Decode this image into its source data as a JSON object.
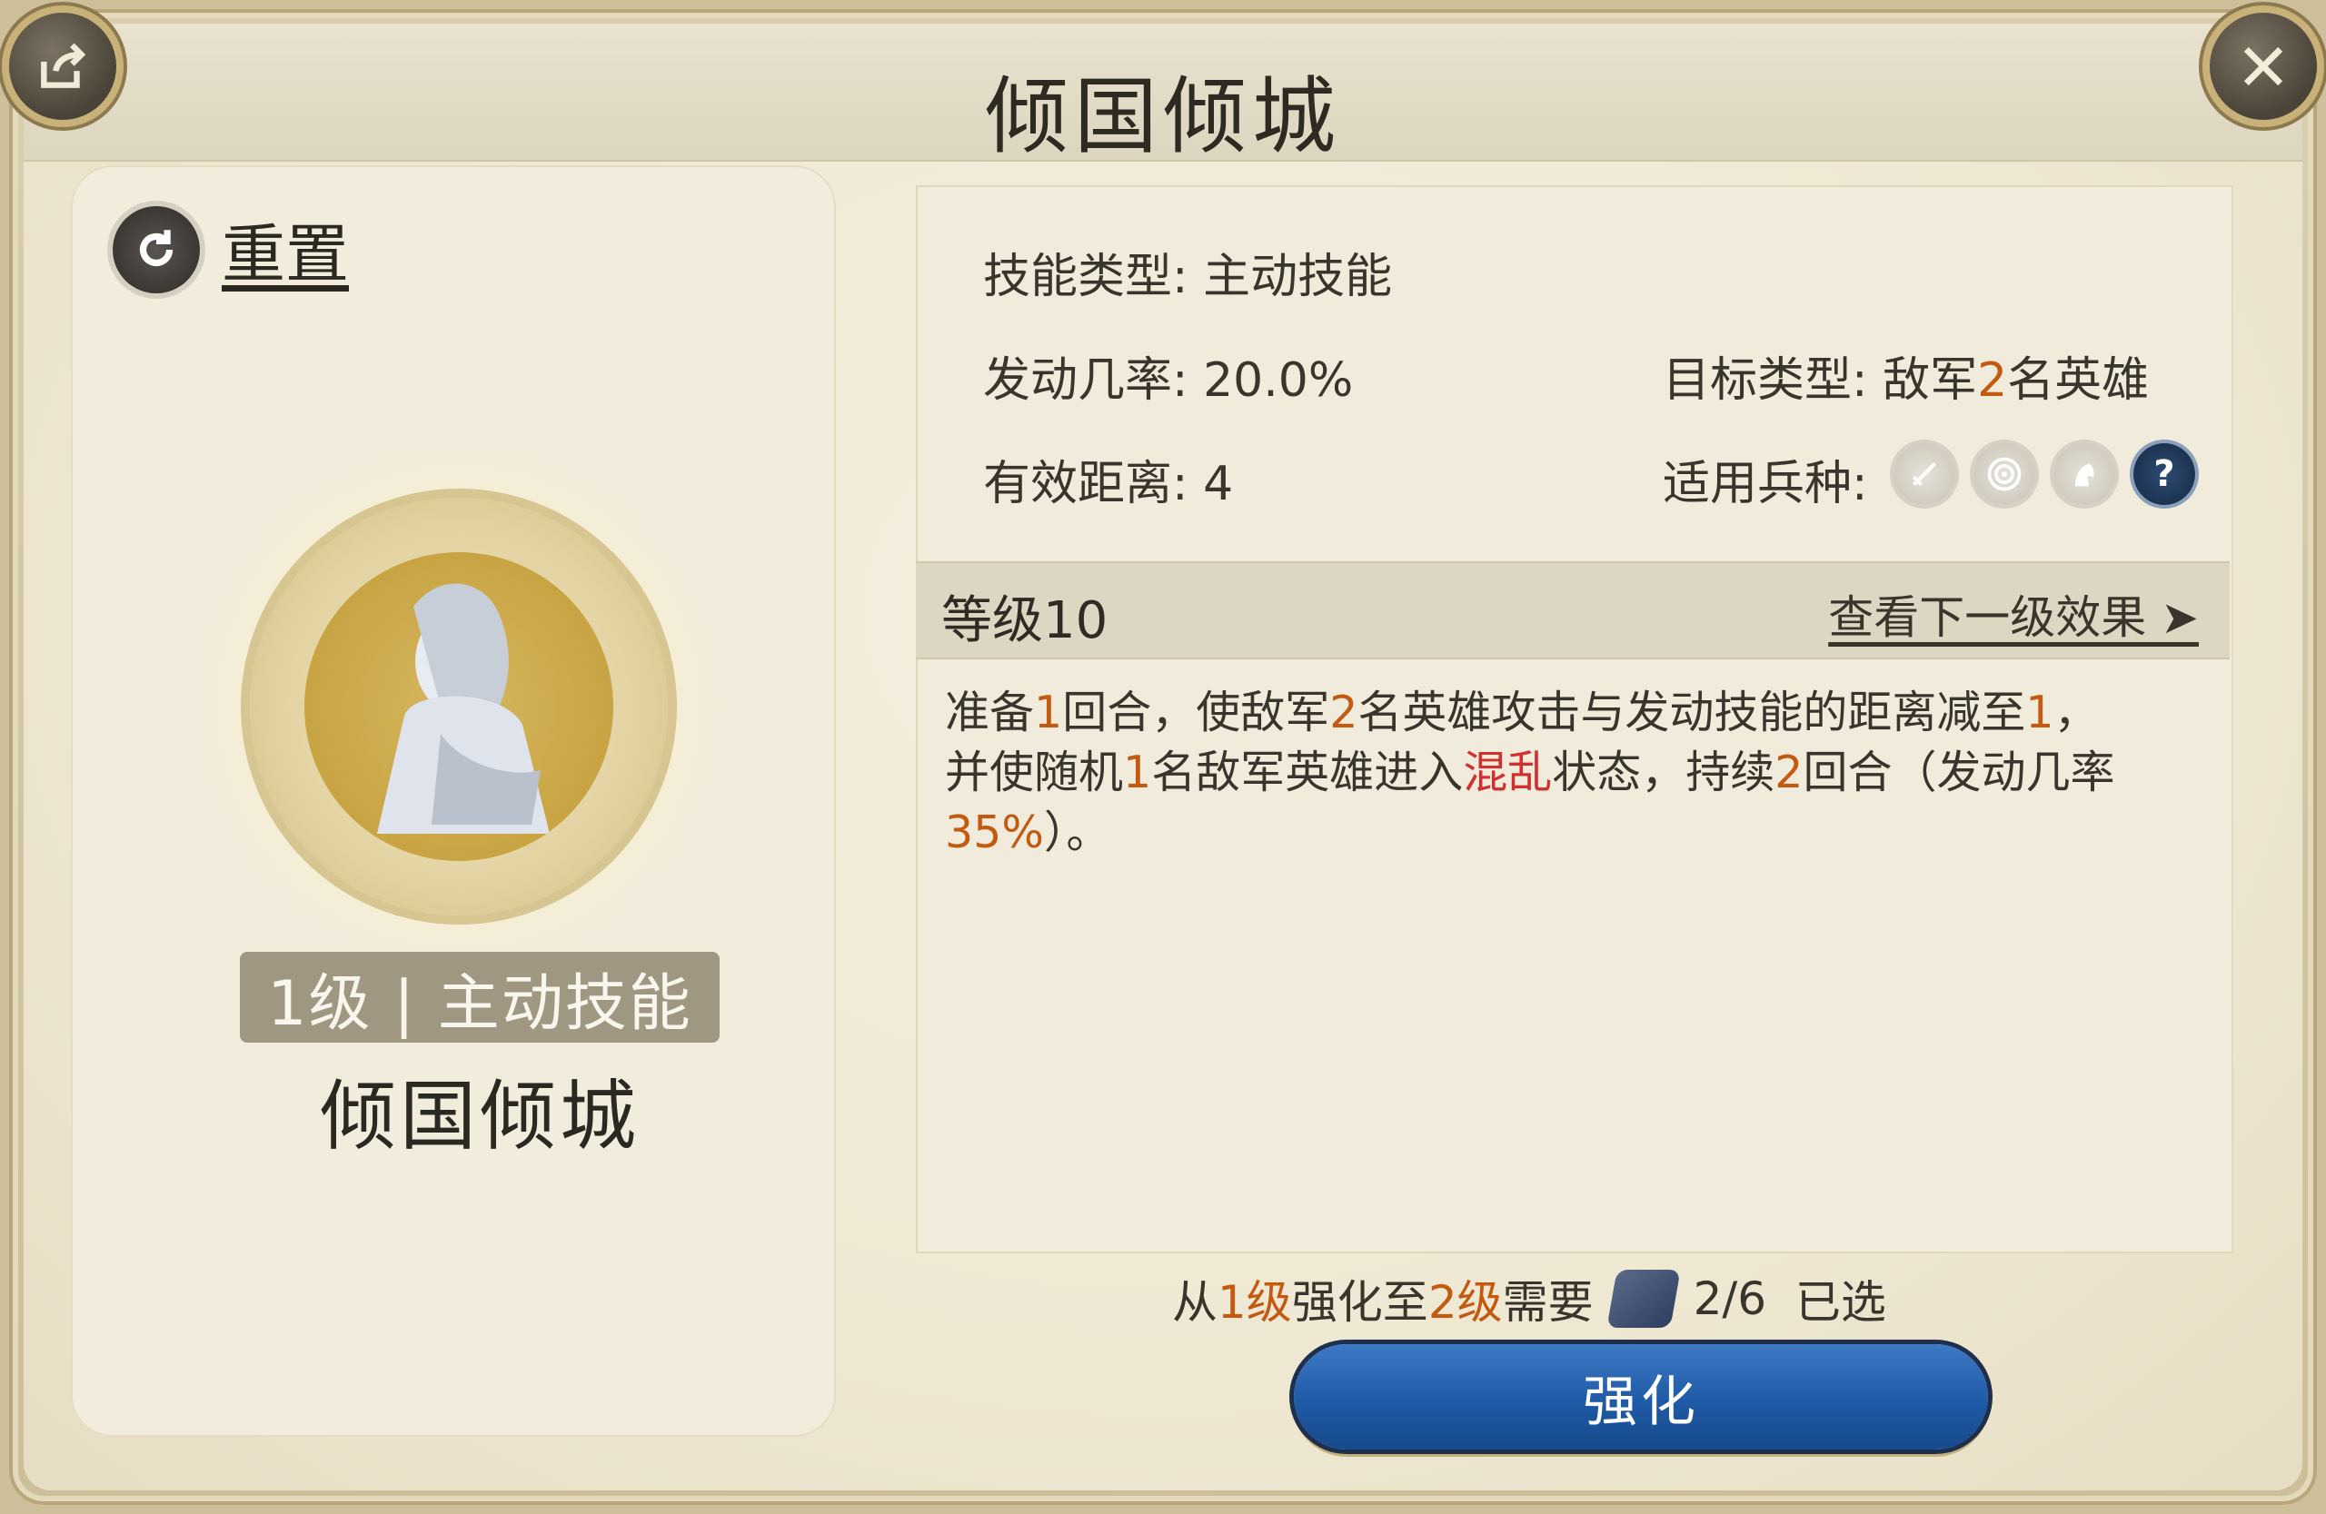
{
  "header": {
    "title": "倾国倾城"
  },
  "left": {
    "reset_label": "重置",
    "level_badge": "1级 | 主动技能",
    "skill_name": "倾国倾城"
  },
  "info": {
    "skill_type_label": "技能类型:",
    "skill_type_value": "主动技能",
    "trigger_rate_label": "发动几率:",
    "trigger_rate_value": "20.0%",
    "target_type_label": "目标类型:",
    "target_type_value_prefix": "敌军",
    "target_type_value_num": "2",
    "target_type_value_suffix": "名英雄",
    "range_label": "有效距离:",
    "range_value": "4",
    "troop_label": "适用兵种:",
    "troop_icons": [
      "infantry-icon",
      "archer-icon",
      "cavalry-icon",
      "help-icon"
    ],
    "help_glyph": "?"
  },
  "level_bar": {
    "level": "等级10",
    "next_effect": "查看下一级效果 ➤"
  },
  "description": {
    "line1_a": "准备",
    "line1_n1": "1",
    "line1_b": "回合，使敌军",
    "line1_n2": "2",
    "line1_c": "名英雄攻击与发动技能的距离减至",
    "line1_n3": "1",
    "line1_d": "，",
    "line2_a": "并使随机",
    "line2_n1": "1",
    "line2_b": "名敌军英雄进入",
    "line2_status": "混乱",
    "line2_c": "状态，持续",
    "line2_n2": "2",
    "line2_d": "回合（发动几率",
    "line3_pct": "35%",
    "line3_e": "）。"
  },
  "upgrade": {
    "from_text": "从",
    "from_level": "1级",
    "to_text": " 强化至 ",
    "to_level": "2级",
    "need_text": "需要",
    "amount": "2/6",
    "amount_suffix": "已选",
    "button_label": "强化"
  },
  "colors": {
    "accent_orange": "#c35a10",
    "status_red": "#d23030",
    "button_blue": "#1f5aa6"
  }
}
